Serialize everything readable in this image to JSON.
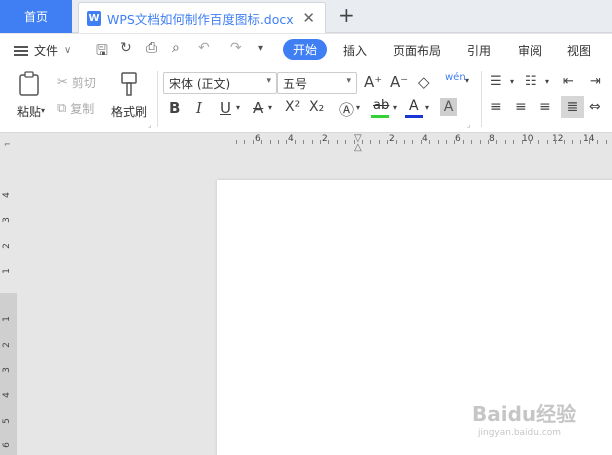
{
  "tabbar": {
    "home_label": "首页",
    "doc_icon": "W",
    "doc_title": "WPS文档如何制作百度图标.docx",
    "close_glyph": "✕",
    "new_tab_glyph": "+"
  },
  "menu": {
    "file_label": "文件",
    "tabs": [
      "开始",
      "插入",
      "页面布局",
      "引用",
      "审阅",
      "视图"
    ],
    "active_tab": "开始"
  },
  "ribbon": {
    "paste_label": "粘贴",
    "cut_label": "剪切",
    "copy_label": "复制",
    "format_painter_label": "格式刷",
    "font_family": "宋体 (正文)",
    "font_size": "五号",
    "bold": "B",
    "italic": "I",
    "underline": "U",
    "strike": "A",
    "superscript": "X²",
    "subscript": "X₂",
    "font_grow": "A⁺",
    "font_shrink": "A⁻",
    "pinyin": "wén",
    "highlight": "ab",
    "font_color": "A",
    "char_shading": "A",
    "highlight_color": "#35d135",
    "font_color_value": "#1a35d6"
  },
  "ruler": {
    "h_numbers": [
      "6",
      "4",
      "2",
      "2",
      "4",
      "6",
      "8",
      "10",
      "12",
      "14",
      "16"
    ],
    "v_numbers": [
      "4",
      "3",
      "2",
      "1",
      "1",
      "2",
      "3",
      "4",
      "5",
      "6"
    ]
  },
  "watermark": {
    "text": "Baidu经验",
    "url": "jingyan.baidu.com"
  },
  "colors": {
    "accent": "#3f7ff3"
  }
}
